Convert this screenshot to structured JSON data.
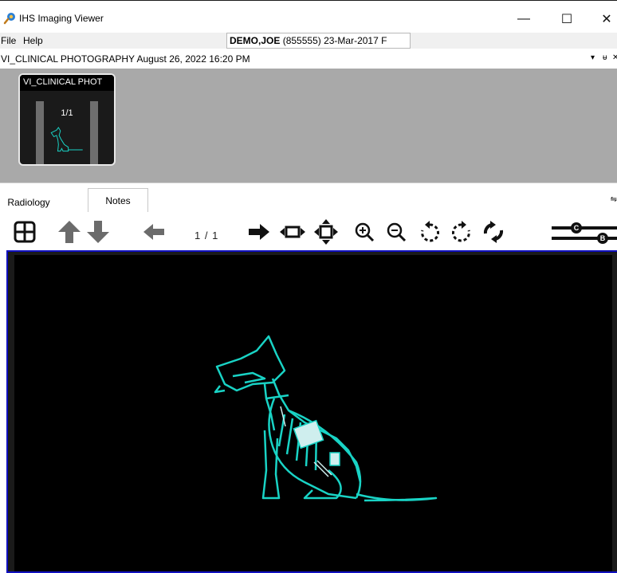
{
  "window": {
    "title": "IHS Imaging Viewer",
    "minimize": "—",
    "maximize": "☐",
    "close": "✕"
  },
  "menu": {
    "file": "File",
    "help": "Help"
  },
  "patient": {
    "name": "DEMO,JOE",
    "details": "(855555) 23-Mar-2017 F"
  },
  "series": {
    "title": "VI_CLINICAL PHOTOGRAPHY  August 26, 2022 16:20 PM",
    "dropdown": "▾",
    "pin": "ᵾ",
    "close": "✕"
  },
  "thumbnail": {
    "label": "VI_CLINICAL PHOT",
    "count": "1/1"
  },
  "tabs": [
    {
      "label": "Radiology"
    },
    {
      "label": "Notes"
    }
  ],
  "tab_overflow": "⇋",
  "toolbar": {
    "page_indicator": "1 / 1",
    "slider_c_label": "C",
    "slider_b_label": "B"
  },
  "colors": {
    "xray": "#19d3c5",
    "viewer_border": "#1010c0",
    "thumb_panel": "#a9a9a9"
  }
}
